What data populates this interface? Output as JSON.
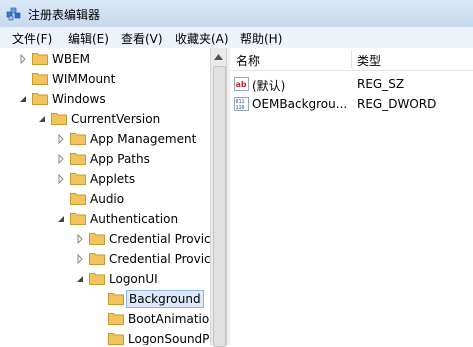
{
  "window": {
    "title": "注册表编辑器"
  },
  "menu": {
    "file": "文件(F)",
    "edit": "编辑(E)",
    "view": "查看(V)",
    "favorites": "收藏夹(A)",
    "help": "帮助(H)"
  },
  "tree": {
    "items": [
      {
        "label": "WBEM"
      },
      {
        "label": "WIMMount"
      },
      {
        "label": "Windows"
      },
      {
        "label": "CurrentVersion"
      },
      {
        "label": "App Management"
      },
      {
        "label": "App Paths"
      },
      {
        "label": "Applets"
      },
      {
        "label": "Audio"
      },
      {
        "label": "Authentication"
      },
      {
        "label": "Credential Provic"
      },
      {
        "label": "Credential Provic"
      },
      {
        "label": "LogonUI"
      },
      {
        "label": "Background"
      },
      {
        "label": "BootAnimatio"
      },
      {
        "label": "LogonSoundP"
      }
    ]
  },
  "list": {
    "header": {
      "name": "名称",
      "type": "类型"
    },
    "values": [
      {
        "icon": "string-value-icon",
        "name": "(默认)",
        "type": "REG_SZ"
      },
      {
        "icon": "dword-value-icon",
        "name": "OEMBackgrou...",
        "type": "REG_DWORD"
      }
    ]
  },
  "colors": {
    "selection_bg": "#dbe9fb",
    "selection_border": "#8fb5e3",
    "folder": "#f2c55c"
  }
}
